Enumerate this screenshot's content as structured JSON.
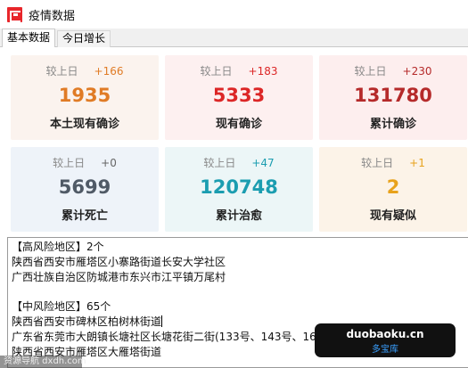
{
  "window": {
    "title": "疫情数据"
  },
  "tabs": [
    {
      "label": "基本数据",
      "active": true
    },
    {
      "label": "今日增长",
      "active": false
    }
  ],
  "cards": [
    {
      "compare_label": "较上日",
      "delta": "+166",
      "value": "1935",
      "label": "本土现有确诊",
      "bg": "#fbf3ee",
      "value_color": "#e07b25",
      "delta_color": "#e07b25"
    },
    {
      "compare_label": "较上日",
      "delta": "+183",
      "value": "5333",
      "label": "现有确诊",
      "bg": "#fdf0f0",
      "value_color": "#dc2626",
      "delta_color": "#dc2626"
    },
    {
      "compare_label": "较上日",
      "delta": "+230",
      "value": "131780",
      "label": "累计确诊",
      "bg": "#fdeeee",
      "value_color": "#b52a2a",
      "delta_color": "#b52a2a"
    },
    {
      "compare_label": "较上日",
      "delta": "+0",
      "value": "5699",
      "label": "累计死亡",
      "bg": "#eef3f9",
      "value_color": "#505a66",
      "delta_color": "#666666"
    },
    {
      "compare_label": "较上日",
      "delta": "+47",
      "value": "120748",
      "label": "累计治愈",
      "bg": "#ecf6f7",
      "value_color": "#1b9db0",
      "delta_color": "#1b9db0"
    },
    {
      "compare_label": "较上日",
      "delta": "+1",
      "value": "2",
      "label": "现有疑似",
      "bg": "#fcf3e8",
      "value_color": "#e8a21c",
      "delta_color": "#e8a21c"
    }
  ],
  "risk_text": {
    "lines": [
      "【高风险地区】2个",
      "陕西省西安市雁塔区小寨路街道长安大学社区",
      "广西壮族自治区防城港市东兴市江平镇万尾村",
      "",
      "【中风险地区】65个",
      "陕西省西安市碑林区柏树林街道",
      "广东省东莞市大朗镇长塘社区长塘花街二街(133号、143号、163号)",
      "陕西省西安市雁塔区大雁塔街道"
    ]
  },
  "watermarks": {
    "left": "资源导航 dxdh.com",
    "right_domain": "duobaoku.cn",
    "right_name": "多宝库"
  },
  "colors": {
    "accent_red": "#e8262b"
  }
}
